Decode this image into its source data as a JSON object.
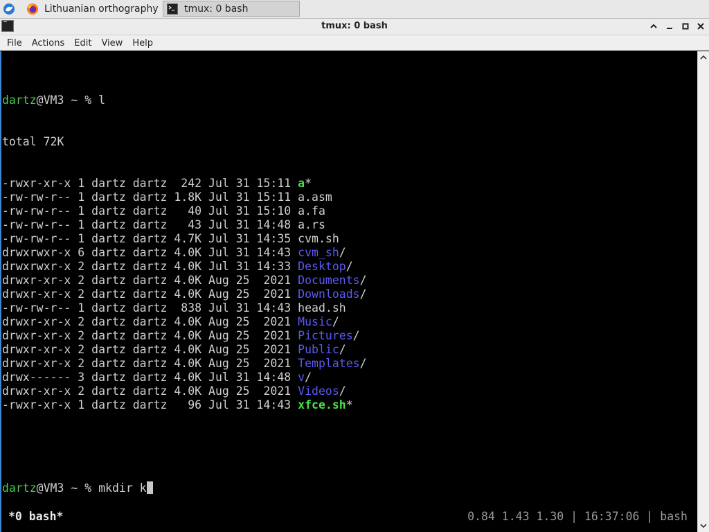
{
  "taskbar": {
    "tasks": [
      {
        "label": "Lithuanian orthography ...",
        "icon": "firefox-icon"
      },
      {
        "label": "tmux: 0 bash",
        "icon": "terminal-icon"
      }
    ]
  },
  "window": {
    "title": "tmux: 0 bash"
  },
  "menu": [
    "File",
    "Actions",
    "Edit",
    "View",
    "Help"
  ],
  "terminal": {
    "prompt_user": "dartz",
    "prompt_rest": "@VM3 ~ % ",
    "first_command": "l",
    "total": "total 72K",
    "listing": [
      {
        "meta": "-rwxr-xr-x 1 dartz dartz  242 Jul 31 15:11 ",
        "name": "a",
        "suffix": "*",
        "kind": "exe"
      },
      {
        "meta": "-rw-rw-r-- 1 dartz dartz 1.8K Jul 31 15:11 ",
        "name": "a.asm",
        "suffix": "",
        "kind": "file"
      },
      {
        "meta": "-rw-rw-r-- 1 dartz dartz   40 Jul 31 15:10 ",
        "name": "a.fa",
        "suffix": "",
        "kind": "file"
      },
      {
        "meta": "-rw-rw-r-- 1 dartz dartz   43 Jul 31 14:48 ",
        "name": "a.rs",
        "suffix": "",
        "kind": "file"
      },
      {
        "meta": "-rw-rw-r-- 1 dartz dartz 4.7K Jul 31 14:35 ",
        "name": "cvm.sh",
        "suffix": "",
        "kind": "file"
      },
      {
        "meta": "drwxrwxr-x 6 dartz dartz 4.0K Jul 31 14:43 ",
        "name": "cvm_sh",
        "suffix": "/",
        "kind": "dir"
      },
      {
        "meta": "drwxrwxr-x 2 dartz dartz 4.0K Jul 31 14:33 ",
        "name": "Desktop",
        "suffix": "/",
        "kind": "dir"
      },
      {
        "meta": "drwxr-xr-x 2 dartz dartz 4.0K Aug 25  2021 ",
        "name": "Documents",
        "suffix": "/",
        "kind": "dir"
      },
      {
        "meta": "drwxr-xr-x 2 dartz dartz 4.0K Aug 25  2021 ",
        "name": "Downloads",
        "suffix": "/",
        "kind": "dir"
      },
      {
        "meta": "-rw-rw-r-- 1 dartz dartz  838 Jul 31 14:43 ",
        "name": "head.sh",
        "suffix": "",
        "kind": "file"
      },
      {
        "meta": "drwxr-xr-x 2 dartz dartz 4.0K Aug 25  2021 ",
        "name": "Music",
        "suffix": "/",
        "kind": "dir"
      },
      {
        "meta": "drwxr-xr-x 2 dartz dartz 4.0K Aug 25  2021 ",
        "name": "Pictures",
        "suffix": "/",
        "kind": "dir"
      },
      {
        "meta": "drwxr-xr-x 2 dartz dartz 4.0K Aug 25  2021 ",
        "name": "Public",
        "suffix": "/",
        "kind": "dir"
      },
      {
        "meta": "drwxr-xr-x 2 dartz dartz 4.0K Aug 25  2021 ",
        "name": "Templates",
        "suffix": "/",
        "kind": "dir"
      },
      {
        "meta": "drwx------ 3 dartz dartz 4.0K Jul 31 14:48 ",
        "name": "v",
        "suffix": "/",
        "kind": "dir"
      },
      {
        "meta": "drwxr-xr-x 2 dartz dartz 4.0K Aug 25  2021 ",
        "name": "Videos",
        "suffix": "/",
        "kind": "dir"
      },
      {
        "meta": "-rwxr-xr-x 1 dartz dartz   96 Jul 31 14:43 ",
        "name": "xfce.sh",
        "suffix": "*",
        "kind": "exe"
      }
    ],
    "second_command": "mkdir k"
  },
  "tmux_status": {
    "window": "*0 bash*",
    "right": "0.84 1.43 1.30 | 16:37:06 | bash"
  },
  "colors": {
    "user": "#4ec94e",
    "dir": "#5a5af2",
    "exe": "#4ae04a",
    "focus_border": "#3b87d6"
  }
}
